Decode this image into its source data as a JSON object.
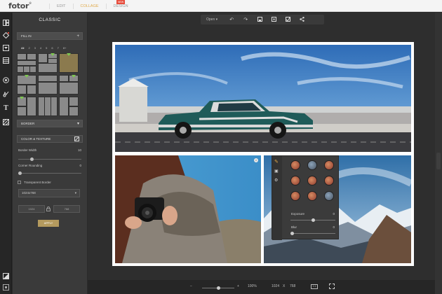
{
  "app": {
    "logo": "fotor",
    "tabs": [
      {
        "label": "EDIT"
      },
      {
        "label": "COLLAGE"
      },
      {
        "label": "DESIGN"
      }
    ],
    "design_badge": "NEW",
    "accent_color": "#e0a94a"
  },
  "left_icons": [
    {
      "name": "collage-layout-icon"
    },
    {
      "name": "stickers-icon"
    },
    {
      "name": "background-icon"
    },
    {
      "name": "template-icon"
    },
    {
      "name": "shapes-icon"
    },
    {
      "name": "frames-icon"
    },
    {
      "name": "text-icon"
    },
    {
      "name": "pattern-icon"
    }
  ],
  "panel": {
    "title": "CLASSIC",
    "fill_in_label": "FILL IN",
    "fill_in_action": "+",
    "counts": [
      "All",
      "2",
      "3",
      "4",
      "5",
      "6",
      "7",
      "8+"
    ],
    "border_label": "BORDER",
    "color_texture_label": "COLOR & TEXTURE",
    "border_width_label": "Border Width",
    "border_width_value": "10",
    "border_width_level": 0.2,
    "corner_rounding_label": "Corner Rounding",
    "corner_rounding_value": "0",
    "corner_rounding_level": 0,
    "transparent_border_label": "Transparent Border",
    "size_select_value": "1024x768",
    "width_value": "1024",
    "height_value": "768",
    "apply_label": "APPLY"
  },
  "toolbar": {
    "open_label": "Open",
    "buttons": [
      "undo-icon",
      "redo-icon",
      "save-icon",
      "resize-icon",
      "crop-icon",
      "share-icon"
    ]
  },
  "effects": {
    "exposure_label": "Exposure",
    "exposure_value": "0",
    "blur_label": "Blur",
    "blur_value": "0"
  },
  "bottom": {
    "zoom_minus": "−",
    "zoom_plus": "+",
    "zoom_percent": "100%",
    "canvas_width": "1024",
    "times": "X",
    "canvas_height": "768",
    "zoom_level": 0.5
  }
}
